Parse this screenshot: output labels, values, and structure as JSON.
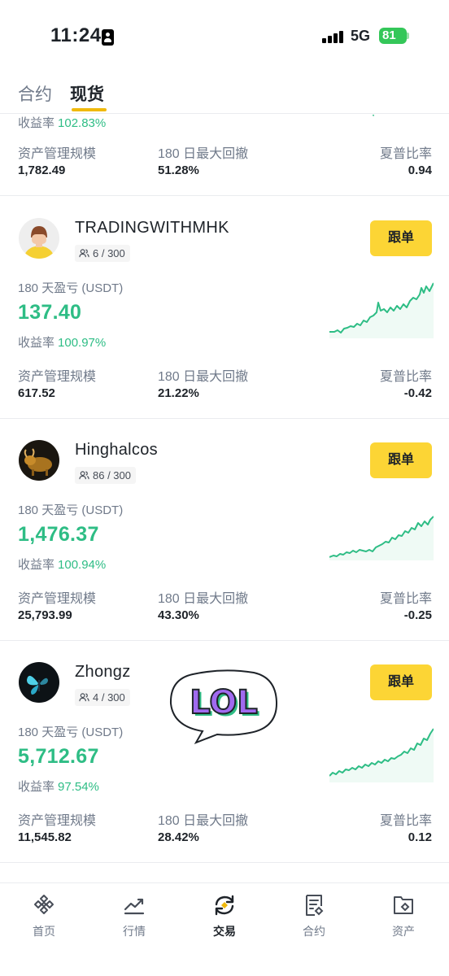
{
  "status_bar": {
    "time": "11:24",
    "network": "5G",
    "battery": "81"
  },
  "tabs": [
    {
      "label": "合约"
    },
    {
      "label": "现货"
    }
  ],
  "labels": {
    "pnl": "180 天盈亏 (USDT)",
    "roi": "收益率",
    "aum": "资产管理规模",
    "mdd": "180 日最大回撤",
    "sharpe": "夏普比率",
    "copy_button": "跟单"
  },
  "partial_card": {
    "roi": "102.83%",
    "aum": "1,782.49",
    "mdd": "51.28%",
    "sharpe": "0.94"
  },
  "traders": [
    {
      "name": "TRADINGWITHMHK",
      "followers": "6 / 300",
      "avatar_icon": "cartoon-person-avatar",
      "pnl": "137.40",
      "roi": "100.97%",
      "aum": "617.52",
      "mdd": "21.22%",
      "sharpe": "-0.42"
    },
    {
      "name": "Hinghalcos",
      "followers": "86 / 300",
      "avatar_icon": "bull-avatar",
      "pnl": "1,476.37",
      "roi": "100.94%",
      "aum": "25,793.99",
      "mdd": "43.30%",
      "sharpe": "-0.25"
    },
    {
      "name": "Zhongz",
      "followers": "4 / 300",
      "avatar_icon": "butterfly-avatar",
      "pnl": "5,712.67",
      "roi": "97.54%",
      "aum": "11,545.82",
      "mdd": "28.42%",
      "sharpe": "0.12"
    }
  ],
  "sticker": {
    "text": "LOL",
    "icon": "lol-speech-bubble-sticker"
  },
  "bottom_nav": [
    {
      "label": "首页",
      "icon": "home-diamond-icon"
    },
    {
      "label": "行情",
      "icon": "market-chart-icon"
    },
    {
      "label": "交易",
      "icon": "trade-swap-icon"
    },
    {
      "label": "合约",
      "icon": "futures-document-icon"
    },
    {
      "label": "资产",
      "icon": "wallet-icon"
    }
  ],
  "colors": {
    "accent": "#fcd535",
    "profit": "#2ebd85",
    "text_primary": "#1e2329",
    "text_secondary": "#707a8a",
    "divider": "#eaecef"
  }
}
